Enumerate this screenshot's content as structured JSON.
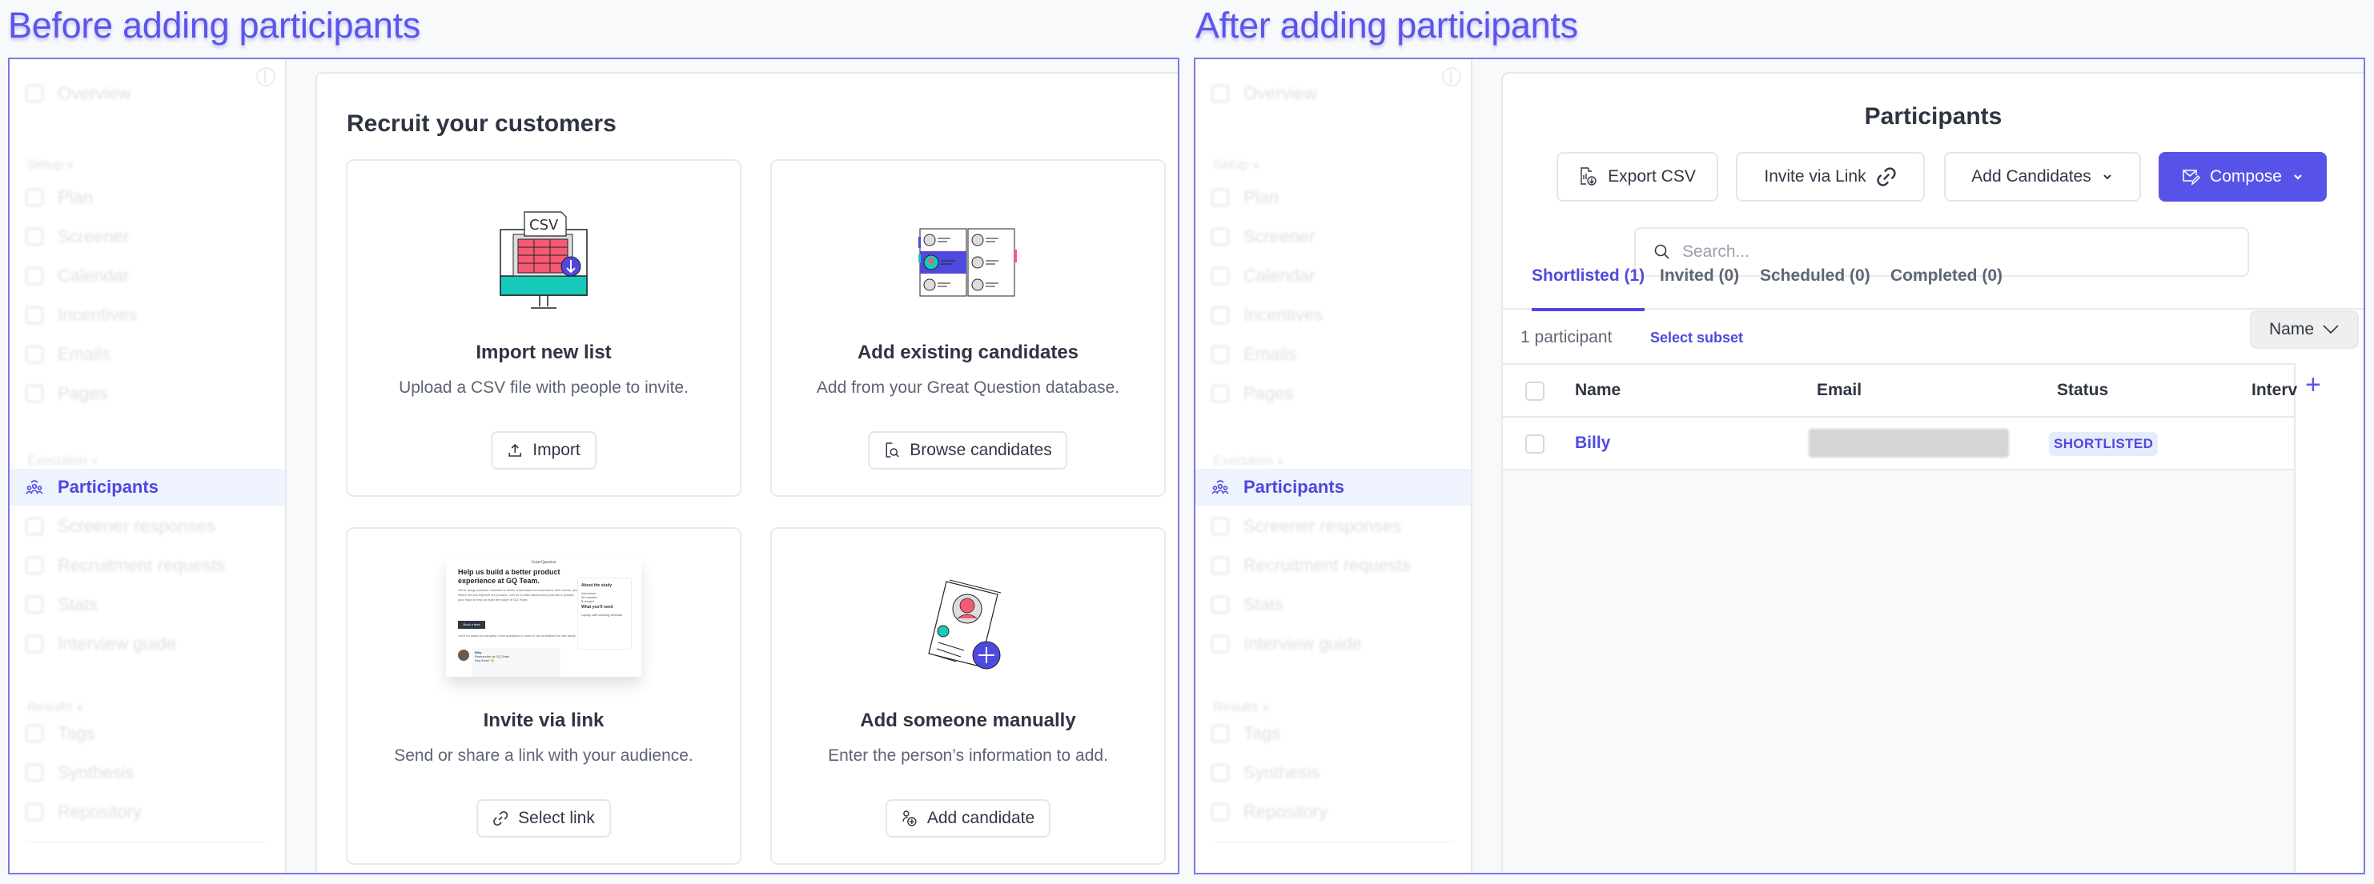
{
  "colors": {
    "accent": "#5853e8",
    "heading": "#5b55ea",
    "frame_border": "#7d78e3",
    "active_bg": "#eef3fe",
    "badge_bg": "#e7ecfd"
  },
  "before": {
    "heading": "Before adding participants",
    "sidebar": {
      "items_top": [
        {
          "label": "Overview",
          "icon": "overview-icon"
        }
      ],
      "sections": [
        {
          "label": "Setup",
          "items": [
            {
              "label": "Plan",
              "icon": "list-icon"
            },
            {
              "label": "Screener",
              "icon": "screener-icon"
            },
            {
              "label": "Calendar",
              "icon": "calendar-icon"
            },
            {
              "label": "Incentives",
              "icon": "incentive-icon"
            },
            {
              "label": "Emails",
              "icon": "mail-icon"
            },
            {
              "label": "Pages",
              "icon": "page-icon"
            }
          ]
        },
        {
          "label": "Execution",
          "items": [
            {
              "label": "Participants",
              "icon": "participants-icon",
              "active": true
            },
            {
              "label": "Screener responses",
              "icon": "responses-icon"
            },
            {
              "label": "Recruitment requests",
              "icon": "recruit-icon"
            },
            {
              "label": "Stats",
              "icon": "stats-icon"
            },
            {
              "label": "Interview guide",
              "icon": "guide-icon"
            }
          ]
        },
        {
          "label": "Results",
          "items": [
            {
              "label": "Tags",
              "icon": "tag-icon"
            },
            {
              "label": "Synthesis",
              "icon": "synthesis-icon"
            },
            {
              "label": "Repository",
              "icon": "repository-icon"
            }
          ]
        }
      ]
    },
    "main": {
      "title": "Recruit your customers",
      "cards": [
        {
          "title": "Import new list",
          "desc": "Upload a CSV file with people to invite.",
          "button": "Import",
          "illustration_label": "CSV"
        },
        {
          "title": "Add existing candidates",
          "desc": "Add from your Great Question database.",
          "button": "Browse candidates"
        },
        {
          "title": "Invite via link",
          "desc": "Send or share a link with your audience.",
          "button": "Select link"
        },
        {
          "title": "Add someone manually",
          "desc": "Enter the person’s information to add.",
          "button": "Add candidate"
        }
      ],
      "thumbnail": {
        "brand": "Great Question",
        "headline": "Help us build a better product experience at GQ Team.",
        "body": "We're doing customer research to better understand our customers, their needs, and where we can improve our product. Join us to learn about new products & provide your input to help us build the future of GQ Team.",
        "cta": "Book a time",
        "note": "You'll be asked to complete a few questions in order to be considered for this study.",
        "about_title": "About the study",
        "about_items": [
          "Interviews",
          "30 minutes",
          "$ reward"
        ],
        "need_title": "What you'll need",
        "need_items": [
          "Laptop with working webcam"
        ],
        "sender": "Billy",
        "sender_role": "Researcher at GQ Team",
        "greeting": "Hey there! 👋"
      }
    }
  },
  "after": {
    "heading": "After adding participants",
    "page_title": "Participants",
    "toolbar": {
      "export": "Export CSV",
      "invite": "Invite via Link",
      "add": "Add Candidates",
      "compose": "Compose"
    },
    "search": {
      "placeholder": "Search...",
      "value": ""
    },
    "tabs": [
      {
        "label": "Shortlisted (1)",
        "active": true
      },
      {
        "label": "Invited (0)"
      },
      {
        "label": "Scheduled (0)"
      },
      {
        "label": "Completed (0)"
      }
    ],
    "count": "1 participant",
    "select_subset": "Select subset",
    "sort": "Name",
    "table": {
      "columns": [
        "Name",
        "Email",
        "Status",
        "Interv"
      ],
      "rows": [
        {
          "name": "Billy",
          "email": "[redacted]",
          "status": "SHORTLISTED"
        }
      ]
    }
  }
}
